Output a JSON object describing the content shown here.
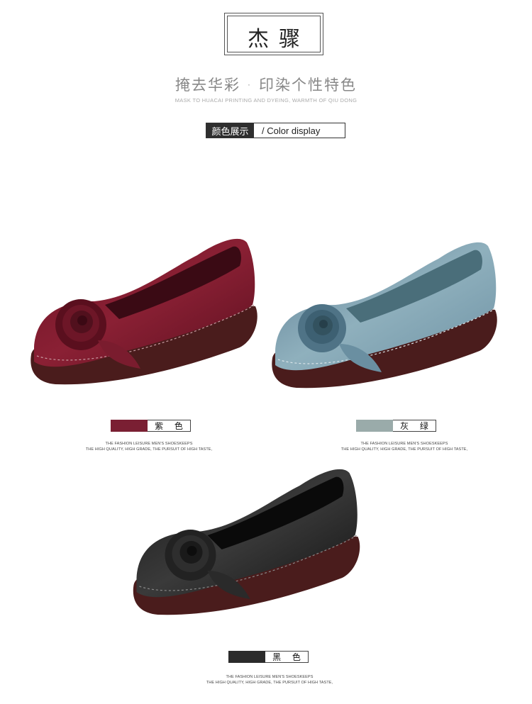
{
  "brand": {
    "name": "杰骤"
  },
  "slogan": {
    "cn": "掩去华彩 · 印染个性特色",
    "en": "MASK TO HUACAI PRINTING AND DYEING, WARMTH OF QIU DONG"
  },
  "section": {
    "cn": "颜色展示",
    "en": "/   Color display"
  },
  "variants": [
    {
      "label": "紫 色",
      "swatch_color": "#7a1f33",
      "line1": "THE FASHION LEISURE MEN'S SHOESKEEPS",
      "line2": "THE HIGH QUALITY, HIGH GRADE, THE PURSUIT OF HIGH TASTE,"
    },
    {
      "label": "灰 绿",
      "swatch_color": "#9aabaa",
      "line1": "THE FASHION LEISURE MEN'S SHOESKEEPS",
      "line2": "THE HIGH QUALITY, HIGH GRADE, THE PURSUIT OF HIGH TASTE,"
    },
    {
      "label": "黑 色",
      "swatch_color": "#2b2b2b",
      "line1": "THE FASHION LEISURE MEN'S SHOESKEEPS",
      "line2": "THE HIGH QUALITY, HIGH GRADE, THE PURSUIT OF HIGH TASTE,"
    }
  ]
}
